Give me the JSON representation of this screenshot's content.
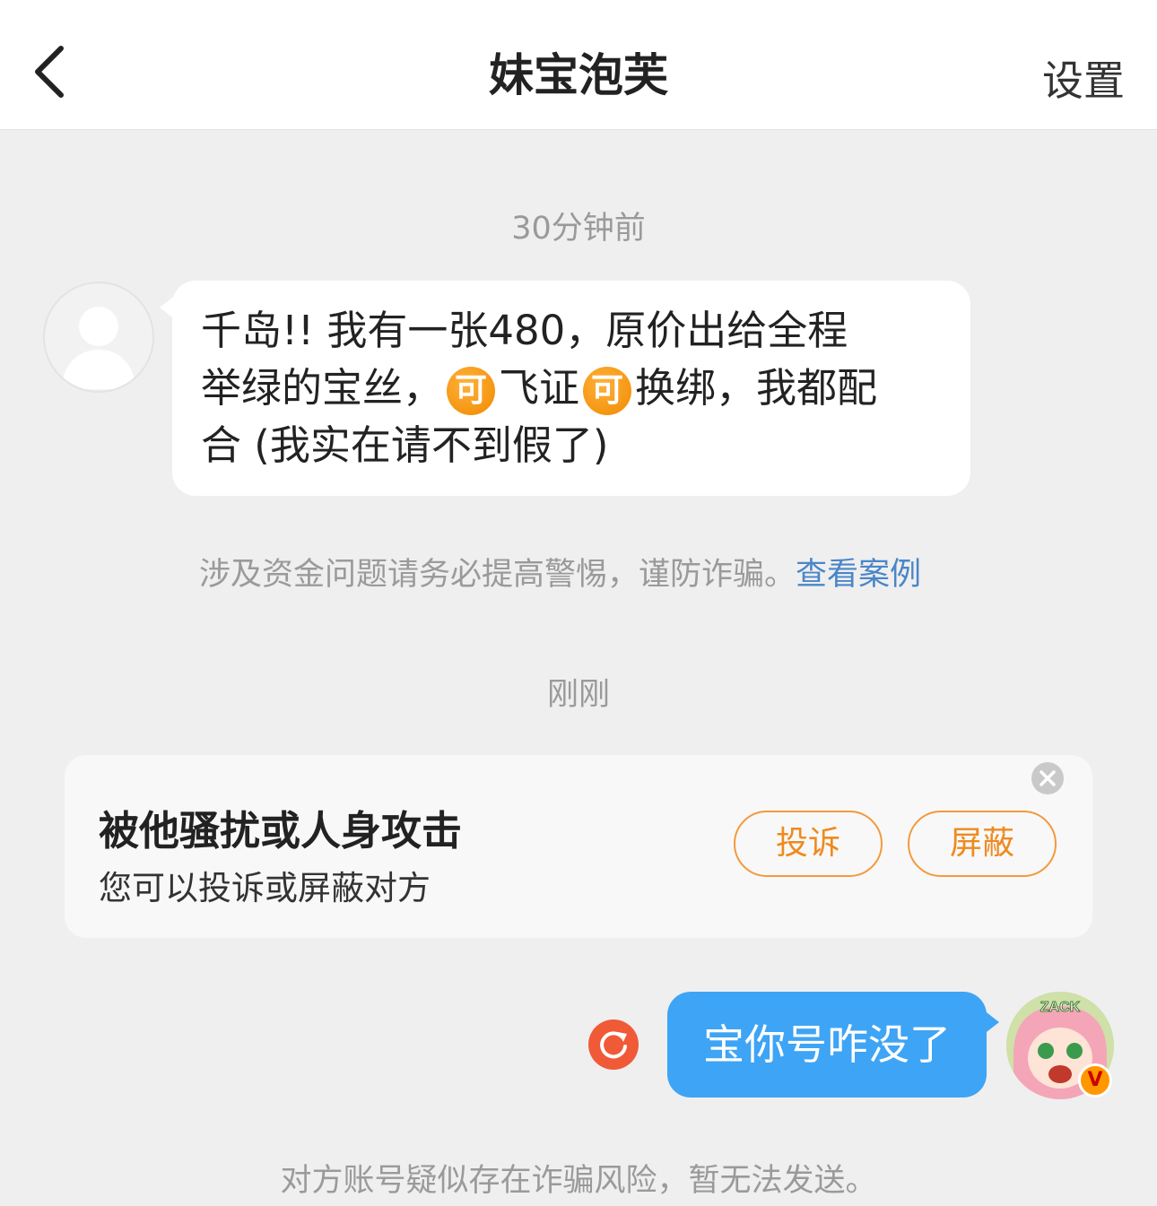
{
  "header": {
    "title": "妹宝泡芙",
    "settings_label": "设置"
  },
  "timestamps": {
    "first": "30分钟前",
    "second": "刚刚"
  },
  "incoming_message": {
    "line1": "千岛!! 我有一张480，原价出给全程",
    "line2_a": "举绿的宝丝，",
    "emoji_text": "可",
    "line2_b": "飞证",
    "line2_c": "换绑，我都配",
    "line3": "合 (我实在请不到假了)"
  },
  "warning": {
    "text": "涉及资金问题请务必提高警惕，谨防诈骗。",
    "link": "查看案例"
  },
  "harassment_card": {
    "title": "被他骚扰或人身攻击",
    "subtitle": "您可以投诉或屏蔽对方",
    "report_label": "投诉",
    "block_label": "屏蔽"
  },
  "outgoing_message": {
    "text": "宝你号咋没了",
    "status": "failed"
  },
  "avatar_right": {
    "top_text": "ZACK"
  },
  "footer": {
    "note": "对方账号疑似存在诈骗风险，暂无法发送。"
  },
  "colors": {
    "accent_orange": "#ef8a1e",
    "bubble_blue": "#3ea4f5",
    "error_red": "#f05a36",
    "link_blue": "#4a86c8"
  }
}
